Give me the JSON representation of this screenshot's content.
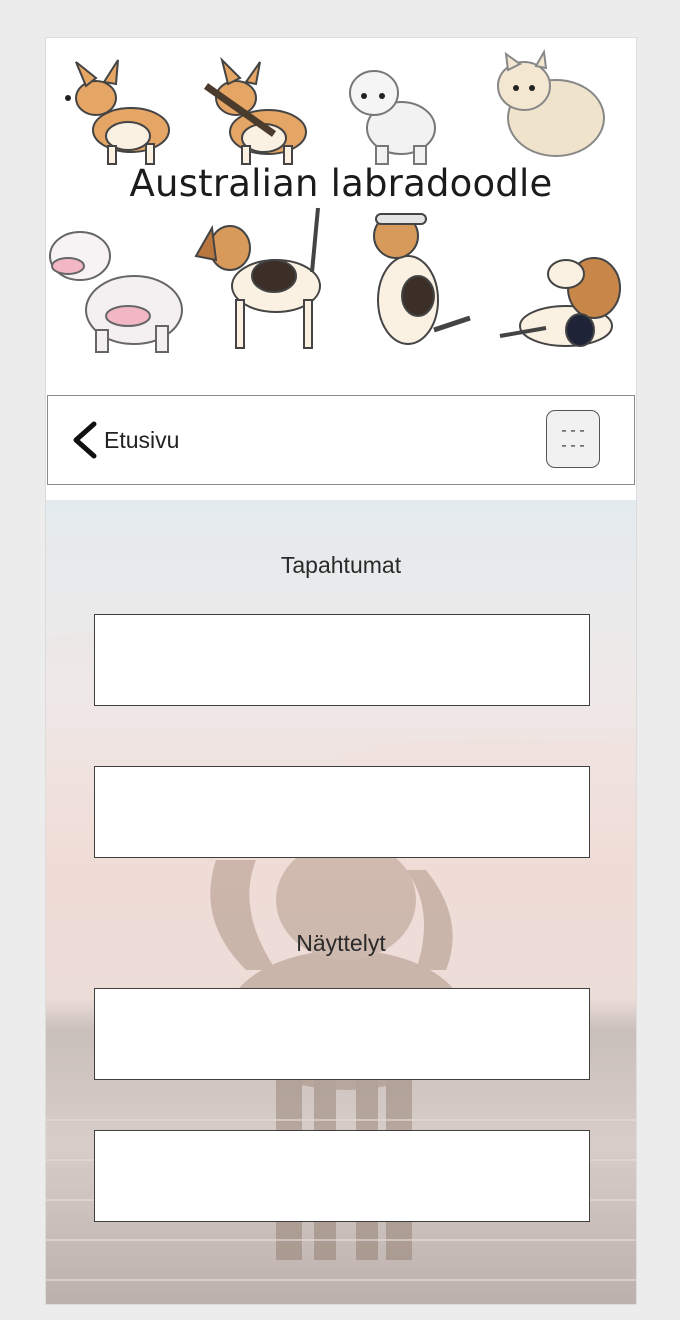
{
  "header": {
    "title": "Australian labradoodle"
  },
  "navbar": {
    "back_label": "Etusivu",
    "menu_icon": "hamburger-menu-icon",
    "menu_glyph_top": "---",
    "menu_glyph_bottom": "---"
  },
  "sections": [
    {
      "label": "Tapahtumat",
      "items": [
        "",
        ""
      ]
    },
    {
      "label": "Näyttelyt",
      "items": [
        "",
        ""
      ]
    }
  ],
  "colors": {
    "page_background": "#ececec",
    "card_border": "#3f3f3f",
    "corgi_tan": "#d99a5b",
    "beagle_brown": "#b07a4a"
  }
}
